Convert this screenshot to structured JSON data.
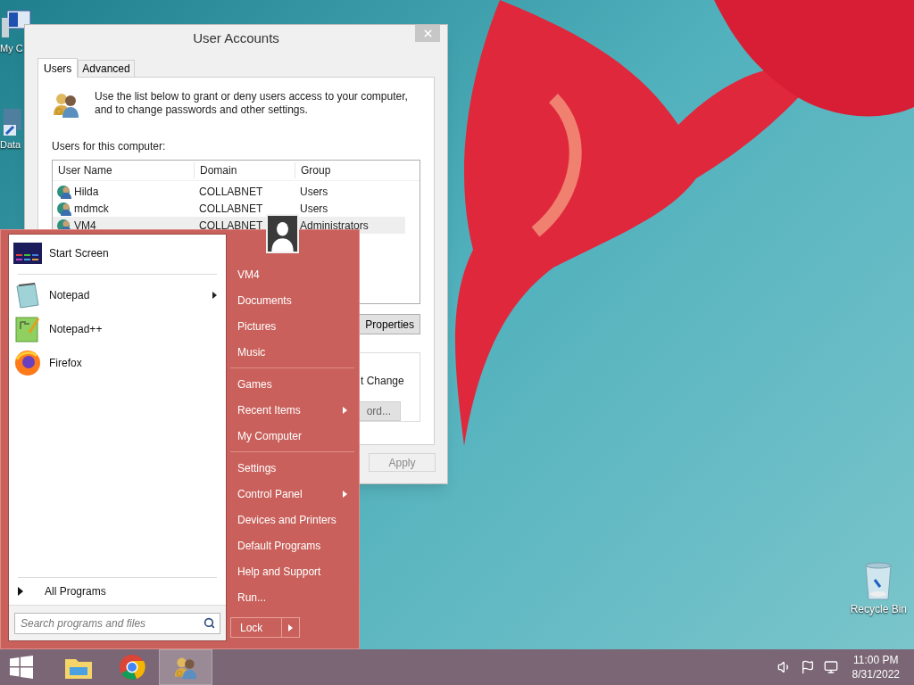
{
  "desktop": {
    "icons": [
      {
        "kind": "computer",
        "label": "My C"
      },
      {
        "kind": "database",
        "label": "Data"
      },
      {
        "kind": "recycle-bin",
        "label": "Recycle Bin"
      }
    ]
  },
  "dialog": {
    "title": "User Accounts",
    "tabs": [
      {
        "label": "Users",
        "selected": true
      },
      {
        "label": "Advanced",
        "selected": false
      }
    ],
    "intro": "Use the list below to grant or deny users access to your computer, and to change passwords and other settings.",
    "list_label": "Users for this computer:",
    "columns": [
      "User Name",
      "Domain",
      "Group"
    ],
    "rows": [
      {
        "cells": [
          "Hilda",
          "COLLABNET",
          "Users"
        ],
        "selected": false
      },
      {
        "cells": [
          "mdmck",
          "COLLABNET",
          "Users"
        ],
        "selected": false
      },
      {
        "cells": [
          "VM4",
          "COLLABNET",
          "Administrators"
        ],
        "selected": true
      }
    ],
    "properties_button": "Properties",
    "group_text": "t Change",
    "password_button": "ord...",
    "apply_button": {
      "label": "Apply",
      "disabled": true
    }
  },
  "start_menu": {
    "pinned": [
      {
        "kind": "start-screen",
        "label": "Start Screen",
        "submenu": false
      },
      {
        "kind": "notepad",
        "label": "Notepad",
        "submenu": true
      },
      {
        "kind": "notepadpp",
        "label": "Notepad++",
        "submenu": false
      },
      {
        "kind": "firefox",
        "label": "Firefox",
        "submenu": false
      }
    ],
    "all_programs": "All Programs",
    "search": {
      "placeholder": "Search programs and files"
    },
    "sections": [
      [
        {
          "label": "VM4",
          "submenu": false
        },
        {
          "label": "Documents",
          "submenu": false
        },
        {
          "label": "Pictures",
          "submenu": false
        },
        {
          "label": "Music",
          "submenu": false
        }
      ],
      [
        {
          "label": "Games",
          "submenu": false
        },
        {
          "label": "Recent Items",
          "submenu": true
        },
        {
          "label": "My Computer",
          "submenu": false
        }
      ],
      [
        {
          "label": "Settings",
          "submenu": false
        },
        {
          "label": "Control Panel",
          "submenu": true
        },
        {
          "label": "Devices and Printers",
          "submenu": false
        },
        {
          "label": "Default Programs",
          "submenu": false
        },
        {
          "label": "Help and Support",
          "submenu": false
        },
        {
          "label": "Run...",
          "submenu": false
        }
      ]
    ],
    "power_button": "Lock"
  },
  "taskbar": {
    "apps": [
      {
        "kind": "explorer",
        "active": false
      },
      {
        "kind": "chrome",
        "active": false
      },
      {
        "kind": "users",
        "active": true
      }
    ],
    "clock": {
      "time": "11:00 PM",
      "date": "8/31/2022"
    }
  }
}
